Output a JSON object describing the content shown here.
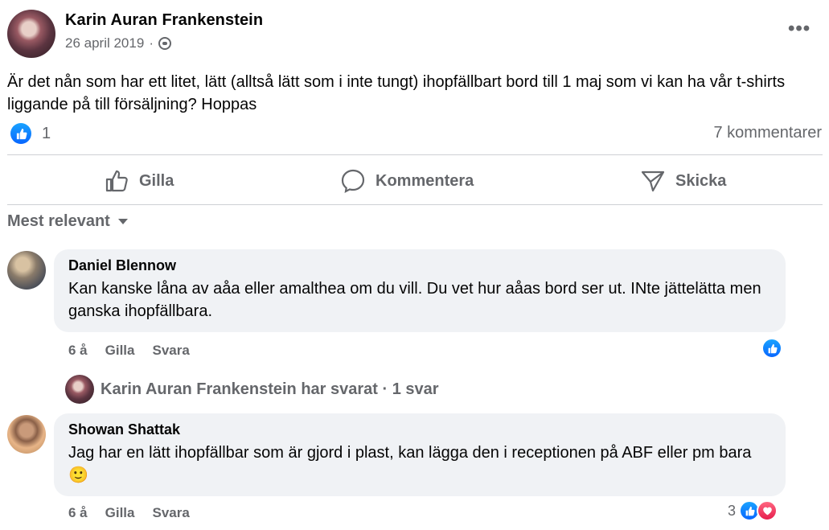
{
  "post": {
    "author": "Karin Auran Frankenstein",
    "date": "26 april 2019",
    "separator": "·",
    "text": "Är det nån som har ett litet, lätt (alltså lätt som i inte tungt) ihopfällbart bord till 1 maj som vi kan ha vår t-shirts liggande på till försäljning? Hoppas",
    "reaction_count": "1",
    "comments_count": "7 kommentarer",
    "more_label": "•••"
  },
  "actions": {
    "like": "Gilla",
    "comment": "Kommentera",
    "share": "Skicka"
  },
  "sort_label": "Mest relevant",
  "comments": [
    {
      "author": "Daniel Blennow",
      "text": "Kan kanske låna av aåa eller amalthea om du vill. Du vet hur aåas bord ser ut. INte jättelätta men ganska ihopfällbara.",
      "time": "6 å",
      "like": "Gilla",
      "reply": "Svara"
    },
    {
      "author": "Showan Shattak",
      "text": "Jag har en lätt ihopfällbar som är gjord i plast, kan lägga den i receptionen på ABF eller pm bara 🙂",
      "time": "6 å",
      "like": "Gilla",
      "reply": "Svara",
      "reaction_count": "3"
    }
  ],
  "reply_summary": {
    "text": "Karin Auran Frankenstein har svarat · 1 svar"
  },
  "colors": {
    "like_blue": "#0866ff",
    "love_red": "#e61e4d",
    "muted": "#65676b",
    "bubble": "#f0f2f5"
  }
}
